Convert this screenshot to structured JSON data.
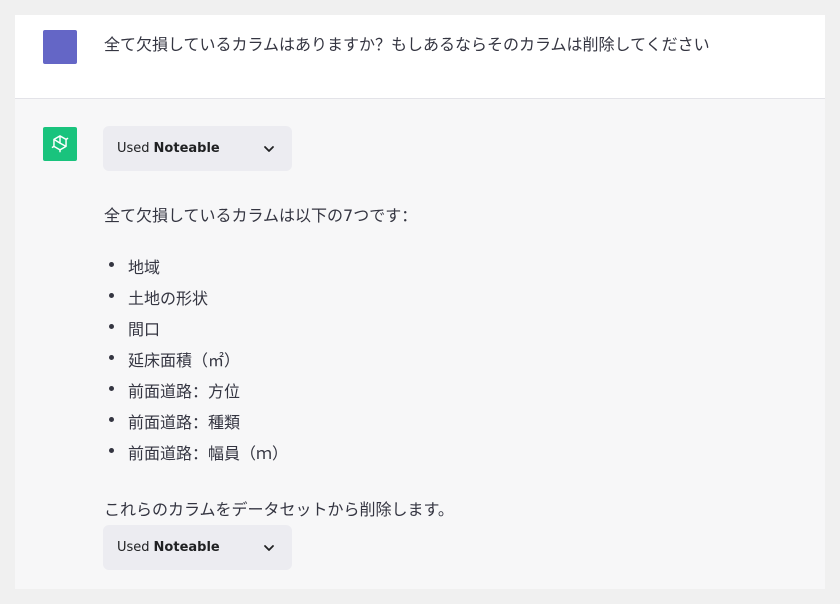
{
  "conversation": {
    "user_message": "全て欠損しているカラムはありますか？もしあるならそのカラムは削除してください",
    "assistant": {
      "plugin_calls": [
        {
          "used_label": "Used",
          "plugin_name": "Noteable"
        },
        {
          "used_label": "Used",
          "plugin_name": "Noteable"
        }
      ],
      "intro": "全て欠損しているカラムは以下の7つです：",
      "columns": [
        "地域",
        "土地の形状",
        "間口",
        "延床面積（㎡）",
        "前面道路：方位",
        "前面道路：種類",
        "前面道路：幅員（ｍ）"
      ],
      "outro": "これらのカラムをデータセットから削除します。"
    }
  },
  "colors": {
    "user_avatar": "#6466c6",
    "assistant_avatar": "#19c37d",
    "pill_background": "#ececf1",
    "assistant_background": "#f7f7f8"
  },
  "icons": {
    "user_avatar": "user-avatar-square",
    "assistant_avatar": "openai-logo-icon",
    "pill_toggle": "chevron-down-icon"
  }
}
